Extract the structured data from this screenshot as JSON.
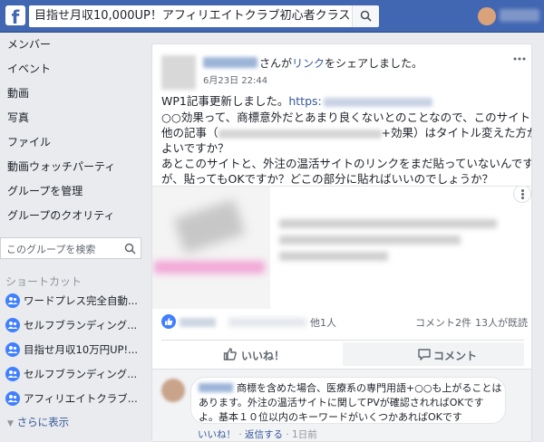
{
  "topbar": {
    "logo": "f",
    "search_value": "目指せ月収10,000UP！アフィリエイトクラブ初心者クラス"
  },
  "sidebar": {
    "items": [
      {
        "label": "メンバー"
      },
      {
        "label": "イベント"
      },
      {
        "label": "動画"
      },
      {
        "label": "写真"
      },
      {
        "label": "ファイル"
      },
      {
        "label": "動画ウォッチパーティ"
      },
      {
        "label": "グループを管理"
      },
      {
        "label": "グループのクオリティ"
      }
    ],
    "search_placeholder": "このグループを検索",
    "shortcuts_heading": "ショートカット",
    "shortcuts": [
      {
        "label": "ワードプレス完全自動..."
      },
      {
        "label": "セルフブランディング..."
      },
      {
        "label": "目指せ月収10万円UP!..."
      },
      {
        "label": "セルフブランディング..."
      },
      {
        "label": "アフィリエイトクラブ..."
      }
    ],
    "show_more": "さらに表示"
  },
  "post": {
    "header_pre": "さんが",
    "header_link": "リンク",
    "header_post": "をシェアしました。",
    "date": "6月23日 22:44",
    "line1_text": "WP1記事更新しました。",
    "line1_link": "https:",
    "line2": "○○効果って、商標意外だとあまり良くないとのことなので、このサイトの",
    "line3_a": "他の記事（",
    "line3_b": "+効果）はタイトル変えた方が",
    "line4": "よいですか？",
    "line5": "あとこのサイトと、外注の温活サイトのリンクをまだ貼っていないんです",
    "line6": "が、貼ってもOKですか？どこの部分に貼ればいいのでしょうか？",
    "reactions_others": "他1人",
    "comment_count": "コメント2件",
    "seen_count": "13人が既読",
    "like_label": "いいね！",
    "comment_label": "コメント"
  },
  "comment": {
    "line1": "商標を含めた場合、医療系の専門用語+○○も上がることは",
    "line2": "あります。外注の温活サイトに関してPVが確認されればOKです",
    "line3": "よ。基本１０位以内のキーワードがいくつかあればOKです",
    "like": "いいね！",
    "sep": " · ",
    "reply": "返信する",
    "time": "1日前"
  },
  "colors": {
    "brand": "#4267b2",
    "link": "#365899",
    "page_bg": "#e9ebee"
  }
}
